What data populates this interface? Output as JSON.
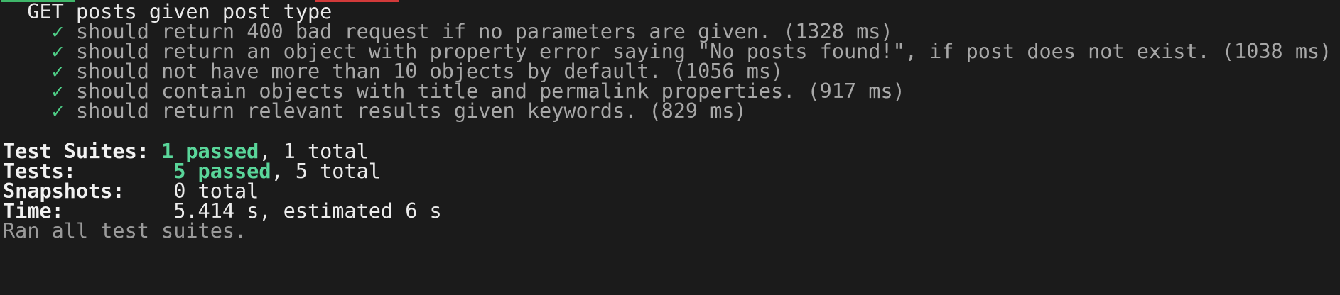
{
  "suite": {
    "title": "GET posts given post type",
    "check_glyph": "✓",
    "tests": [
      {
        "name": "should return 400 bad request if no parameters are given. (1328 ms)"
      },
      {
        "name": "should return an object with property error saying \"No posts found!\", if post does not exist. (1038 ms)"
      },
      {
        "name": "should not have more than 10 objects by default. (1056 ms)"
      },
      {
        "name": "should contain objects with title and permalink properties. (917 ms)"
      },
      {
        "name": "should return relevant results given keywords. (829 ms)"
      }
    ]
  },
  "summary": {
    "suites_label": "Test Suites:",
    "suites_passed": "1 passed",
    "suites_total": ", 1 total",
    "tests_label": "Tests:",
    "tests_passed": "5 passed",
    "tests_total": ", 5 total",
    "snapshots_label": "Snapshots:",
    "snapshots_value": "0 total",
    "time_label": "Time:",
    "time_value": "5.414 s, estimated 6 s",
    "ran_all": "Ran all test suites."
  },
  "colors": {
    "background": "#1b1b1b",
    "pass_green": "#5ad69a",
    "check_green": "#4fcf87",
    "top_bar_green": "#3fb66a",
    "top_bar_red": "#d23a3a",
    "dim_text": "#a8a8a8"
  }
}
